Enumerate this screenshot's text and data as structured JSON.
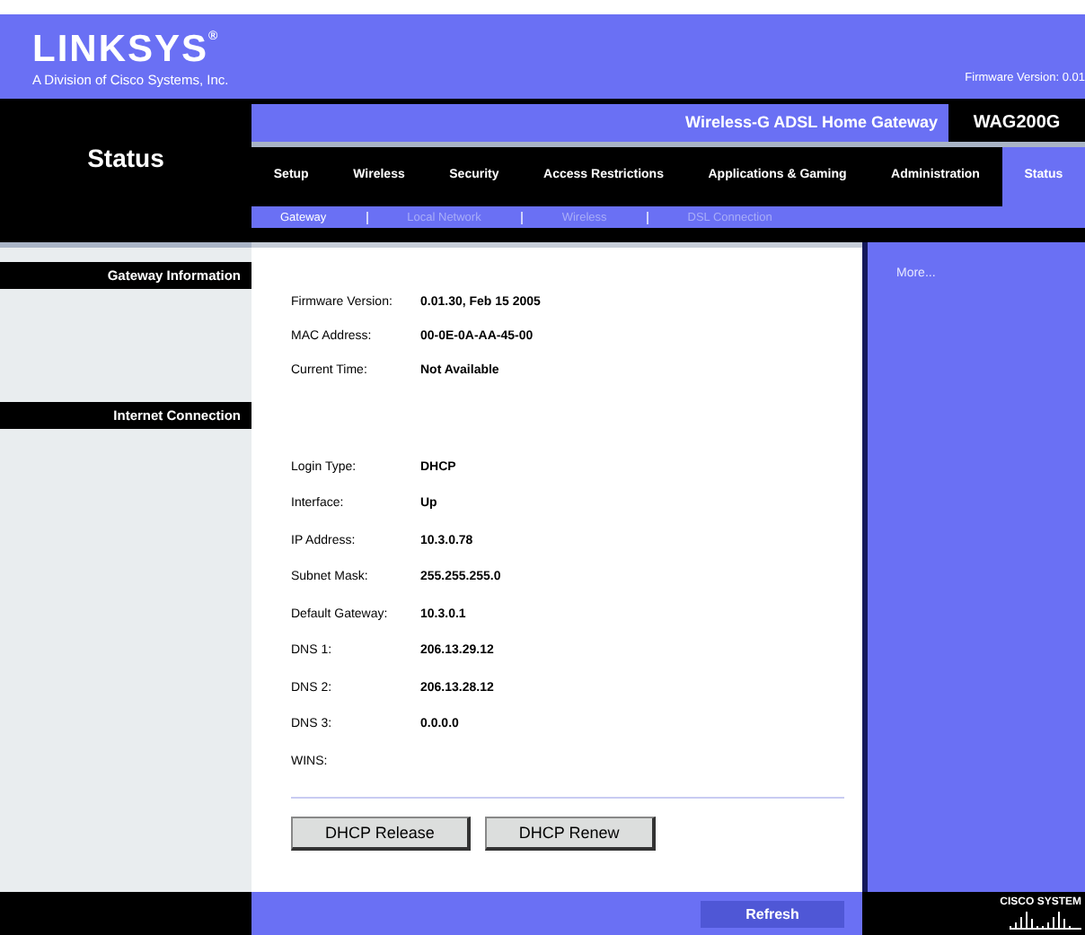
{
  "header": {
    "logo": "LINKSYS$^{®}$",
    "tagline": "A Division of Cisco Systems, Inc.",
    "firmware": "Firmware Version: 0.01"
  },
  "page_title": "Status",
  "product": {
    "name": "Wireless-G ADSL Home Gateway",
    "model": "WAG200G"
  },
  "tabs": [
    {
      "label": "Setup",
      "selected": false
    },
    {
      "label": "Wireless",
      "selected": false
    },
    {
      "label": "Security",
      "selected": false
    },
    {
      "label": "Access Restrictions",
      "selected": false
    },
    {
      "label": "Applications & Gaming",
      "selected": false
    },
    {
      "label": "Administration",
      "selected": false
    },
    {
      "label": "Status",
      "selected": true
    }
  ],
  "subtabs": [
    {
      "label": "Gateway",
      "selected": true
    },
    {
      "label": "Local Network",
      "selected": false
    },
    {
      "label": "Wireless",
      "selected": false
    },
    {
      "label": "DSL Connection",
      "selected": false
    }
  ],
  "sections": [
    {
      "title": "Gateway Information",
      "rows": [
        {
          "label": "Firmware Version:",
          "value": "0.01.30, Feb 15 2005"
        },
        {
          "label": "MAC Address:",
          "value": "00-0E-0A-AA-45-00"
        },
        {
          "label": "Current Time:",
          "value": "Not Available"
        }
      ]
    },
    {
      "title": "Internet Connection",
      "rows": [
        {
          "label": "Login Type:",
          "value": "DHCP"
        },
        {
          "label": "Interface:",
          "value": "Up"
        },
        {
          "label": "IP Address:",
          "value": "10.3.0.78"
        },
        {
          "label": "Subnet Mask:",
          "value": "255.255.255.0"
        },
        {
          "label": "Default Gateway:",
          "value": "10.3.0.1"
        },
        {
          "label": "DNS 1:",
          "value": "206.13.29.12"
        },
        {
          "label": "DNS 2:",
          "value": "206.13.28.12"
        },
        {
          "label": "DNS 3:",
          "value": "0.0.0.0"
        },
        {
          "label": "WINS:"
        }
      ]
    }
  ],
  "buttons": [
    "DHCP Release",
    "DHCP Renew"
  ],
  "more_link": "More...",
  "refresh": "Refresh",
  "footer_logo": "CISCO SYSTEM"
}
